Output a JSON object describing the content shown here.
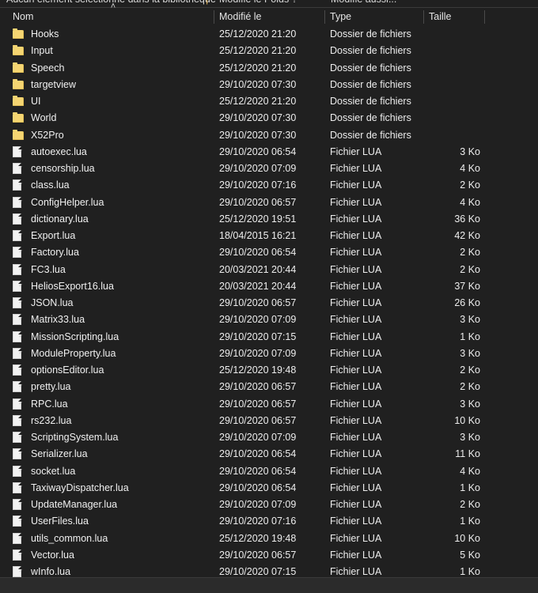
{
  "window": {
    "clipped_top_bar": {
      "left_text": "Aucun élément sélectionné dans la bibliothèque",
      "middle_text": "Modifié le    Poids ?",
      "right_text": "Modifié aussi...",
      "caret": "|"
    }
  },
  "columns": {
    "name": "Nom",
    "modified": "Modifié le",
    "type": "Type",
    "size": "Taille",
    "extra": "",
    "sort_indicator": "˄",
    "sort_column": "Nom",
    "sort_direction": "ascending"
  },
  "colors": {
    "background": "#202020",
    "folder_icon": "#f5d572",
    "file_icon": "#f2f2f2",
    "text": "#f0f0f0",
    "divider": "#4a4a4a",
    "bottom_strip": "#2b2b2b"
  },
  "type_labels": {
    "folder": "Dossier de fichiers",
    "lua": "Fichier LUA"
  },
  "rows": [
    {
      "icon": "folder-icon",
      "kind": "folder",
      "name": "Hooks",
      "modified": "25/12/2020 21:20",
      "type": "Dossier de fichiers",
      "size": ""
    },
    {
      "icon": "folder-icon",
      "kind": "folder",
      "name": "Input",
      "modified": "25/12/2020 21:20",
      "type": "Dossier de fichiers",
      "size": ""
    },
    {
      "icon": "folder-icon",
      "kind": "folder",
      "name": "Speech",
      "modified": "25/12/2020 21:20",
      "type": "Dossier de fichiers",
      "size": ""
    },
    {
      "icon": "folder-icon",
      "kind": "folder",
      "name": "targetview",
      "modified": "29/10/2020 07:30",
      "type": "Dossier de fichiers",
      "size": ""
    },
    {
      "icon": "folder-icon",
      "kind": "folder",
      "name": "UI",
      "modified": "25/12/2020 21:20",
      "type": "Dossier de fichiers",
      "size": ""
    },
    {
      "icon": "folder-icon",
      "kind": "folder",
      "name": "World",
      "modified": "29/10/2020 07:30",
      "type": "Dossier de fichiers",
      "size": ""
    },
    {
      "icon": "folder-icon",
      "kind": "folder",
      "name": "X52Pro",
      "modified": "29/10/2020 07:30",
      "type": "Dossier de fichiers",
      "size": ""
    },
    {
      "icon": "file-icon",
      "kind": "file",
      "name": "autoexec.lua",
      "modified": "29/10/2020 06:54",
      "type": "Fichier LUA",
      "size": "3 Ko"
    },
    {
      "icon": "file-icon",
      "kind": "file",
      "name": "censorship.lua",
      "modified": "29/10/2020 07:09",
      "type": "Fichier LUA",
      "size": "4 Ko"
    },
    {
      "icon": "file-icon",
      "kind": "file",
      "name": "class.lua",
      "modified": "29/10/2020 07:16",
      "type": "Fichier LUA",
      "size": "2 Ko"
    },
    {
      "icon": "file-icon",
      "kind": "file",
      "name": "ConfigHelper.lua",
      "modified": "29/10/2020 06:57",
      "type": "Fichier LUA",
      "size": "4 Ko"
    },
    {
      "icon": "file-icon",
      "kind": "file",
      "name": "dictionary.lua",
      "modified": "25/12/2020 19:51",
      "type": "Fichier LUA",
      "size": "36 Ko"
    },
    {
      "icon": "file-icon",
      "kind": "file",
      "name": "Export.lua",
      "modified": "18/04/2015 16:21",
      "type": "Fichier LUA",
      "size": "42 Ko"
    },
    {
      "icon": "file-icon",
      "kind": "file",
      "name": "Factory.lua",
      "modified": "29/10/2020 06:54",
      "type": "Fichier LUA",
      "size": "2 Ko"
    },
    {
      "icon": "file-icon",
      "kind": "file",
      "name": "FC3.lua",
      "modified": "20/03/2021 20:44",
      "type": "Fichier LUA",
      "size": "2 Ko"
    },
    {
      "icon": "file-icon",
      "kind": "file",
      "name": "HeliosExport16.lua",
      "modified": "20/03/2021 20:44",
      "type": "Fichier LUA",
      "size": "37 Ko"
    },
    {
      "icon": "file-icon",
      "kind": "file",
      "name": "JSON.lua",
      "modified": "29/10/2020 06:57",
      "type": "Fichier LUA",
      "size": "26 Ko"
    },
    {
      "icon": "file-icon",
      "kind": "file",
      "name": "Matrix33.lua",
      "modified": "29/10/2020 07:09",
      "type": "Fichier LUA",
      "size": "3 Ko"
    },
    {
      "icon": "file-icon",
      "kind": "file",
      "name": "MissionScripting.lua",
      "modified": "29/10/2020 07:15",
      "type": "Fichier LUA",
      "size": "1 Ko"
    },
    {
      "icon": "file-icon",
      "kind": "file",
      "name": "ModuleProperty.lua",
      "modified": "29/10/2020 07:09",
      "type": "Fichier LUA",
      "size": "3 Ko"
    },
    {
      "icon": "file-icon",
      "kind": "file",
      "name": "optionsEditor.lua",
      "modified": "25/12/2020 19:48",
      "type": "Fichier LUA",
      "size": "2 Ko"
    },
    {
      "icon": "file-icon",
      "kind": "file",
      "name": "pretty.lua",
      "modified": "29/10/2020 06:57",
      "type": "Fichier LUA",
      "size": "2 Ko"
    },
    {
      "icon": "file-icon",
      "kind": "file",
      "name": "RPC.lua",
      "modified": "29/10/2020 06:57",
      "type": "Fichier LUA",
      "size": "3 Ko"
    },
    {
      "icon": "file-icon",
      "kind": "file",
      "name": "rs232.lua",
      "modified": "29/10/2020 06:57",
      "type": "Fichier LUA",
      "size": "10 Ko"
    },
    {
      "icon": "file-icon",
      "kind": "file",
      "name": "ScriptingSystem.lua",
      "modified": "29/10/2020 07:09",
      "type": "Fichier LUA",
      "size": "3 Ko"
    },
    {
      "icon": "file-icon",
      "kind": "file",
      "name": "Serializer.lua",
      "modified": "29/10/2020 06:54",
      "type": "Fichier LUA",
      "size": "11 Ko"
    },
    {
      "icon": "file-icon",
      "kind": "file",
      "name": "socket.lua",
      "modified": "29/10/2020 06:54",
      "type": "Fichier LUA",
      "size": "4 Ko"
    },
    {
      "icon": "file-icon",
      "kind": "file",
      "name": "TaxiwayDispatcher.lua",
      "modified": "29/10/2020 06:54",
      "type": "Fichier LUA",
      "size": "1 Ko"
    },
    {
      "icon": "file-icon",
      "kind": "file",
      "name": "UpdateManager.lua",
      "modified": "29/10/2020 07:09",
      "type": "Fichier LUA",
      "size": "2 Ko"
    },
    {
      "icon": "file-icon",
      "kind": "file",
      "name": "UserFiles.lua",
      "modified": "29/10/2020 07:16",
      "type": "Fichier LUA",
      "size": "1 Ko"
    },
    {
      "icon": "file-icon",
      "kind": "file",
      "name": "utils_common.lua",
      "modified": "25/12/2020 19:48",
      "type": "Fichier LUA",
      "size": "10 Ko"
    },
    {
      "icon": "file-icon",
      "kind": "file",
      "name": "Vector.lua",
      "modified": "29/10/2020 06:57",
      "type": "Fichier LUA",
      "size": "5 Ko"
    },
    {
      "icon": "file-icon",
      "kind": "file",
      "name": "wInfo.lua",
      "modified": "29/10/2020 07:15",
      "type": "Fichier LUA",
      "size": "1 Ko"
    }
  ]
}
